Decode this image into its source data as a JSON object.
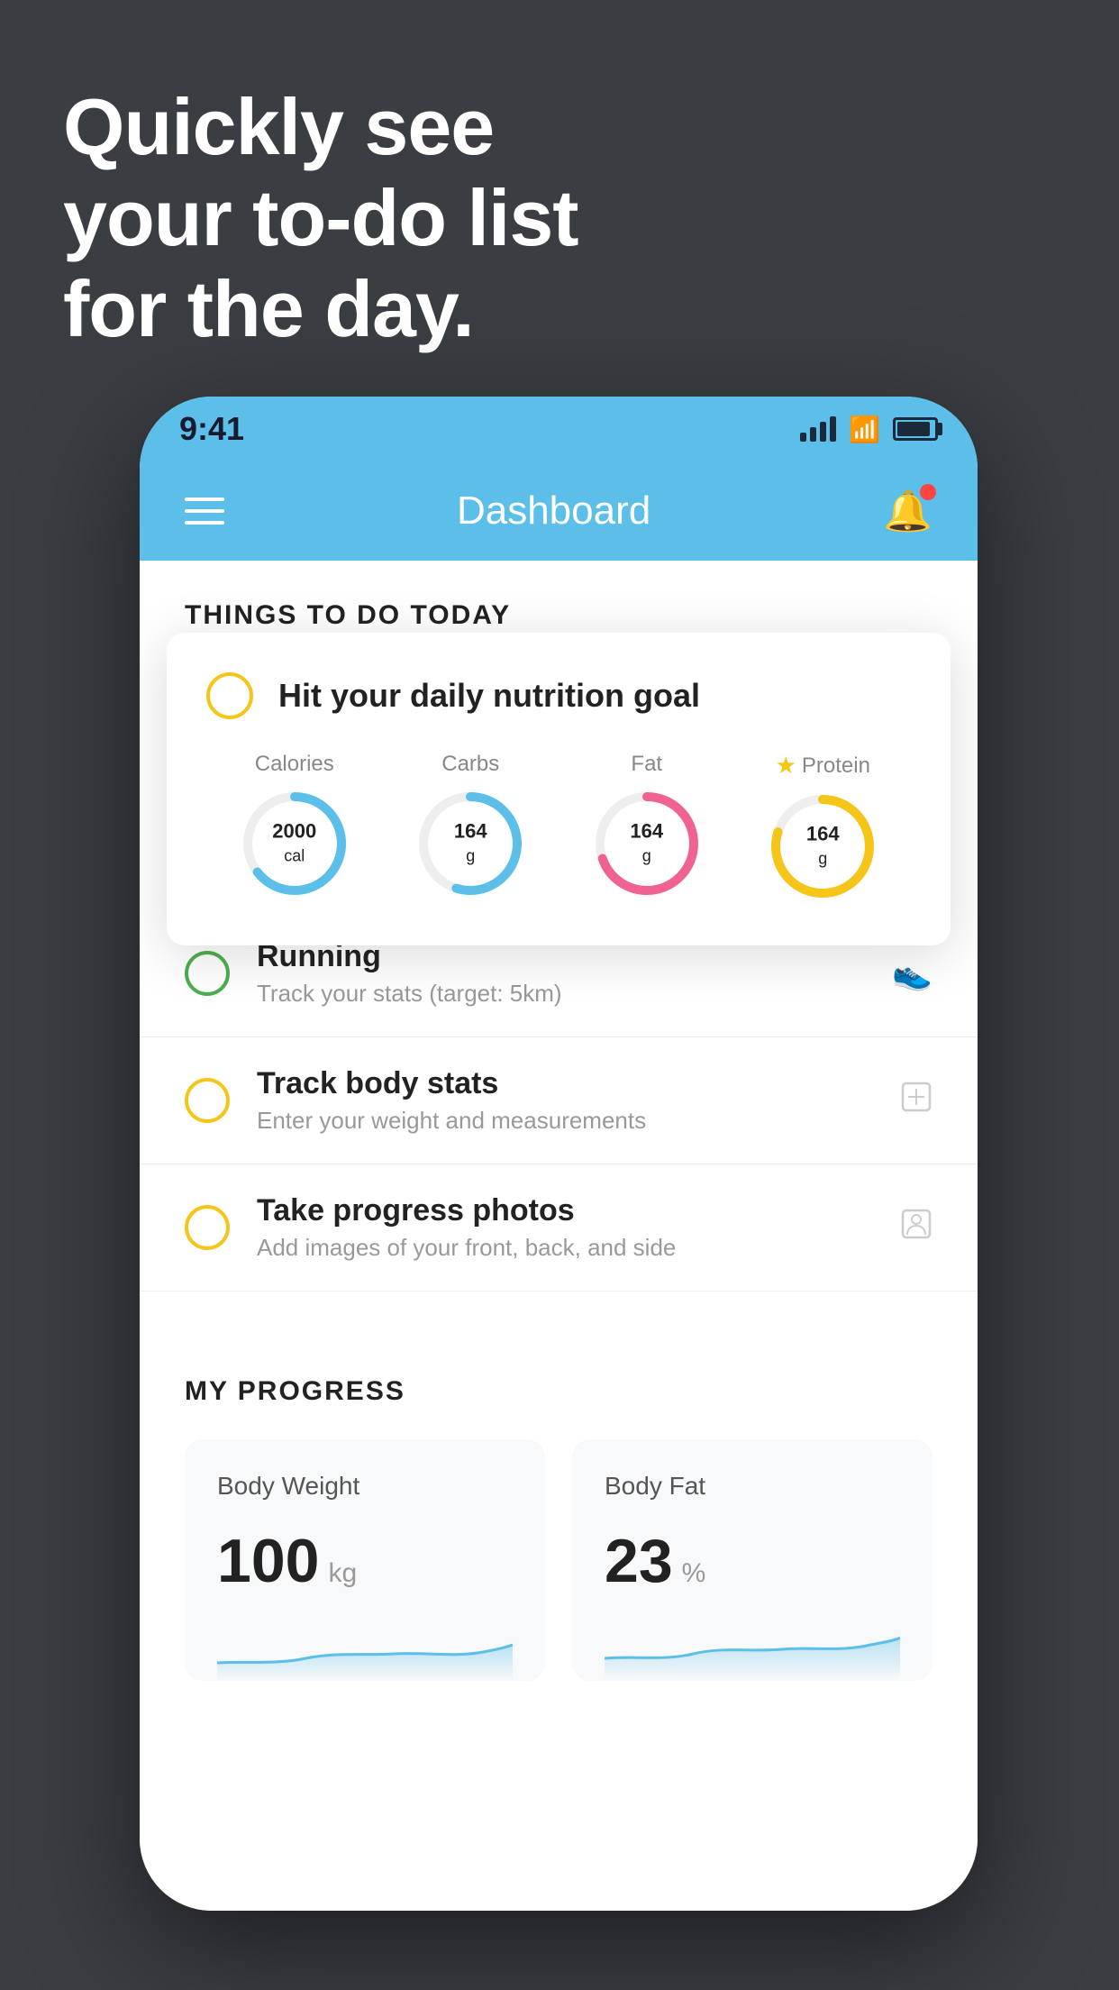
{
  "headline": {
    "line1": "Quickly see",
    "line2": "your to-do list",
    "line3": "for the day."
  },
  "status_bar": {
    "time": "9:41"
  },
  "nav": {
    "title": "Dashboard"
  },
  "things_section": {
    "header": "THINGS TO DO TODAY"
  },
  "floating_card": {
    "title": "Hit your daily nutrition goal",
    "nutrients": [
      {
        "label": "Calories",
        "value": "2000",
        "unit": "cal",
        "color": "#5bbfea",
        "percent": 65
      },
      {
        "label": "Carbs",
        "value": "164",
        "unit": "g",
        "color": "#5bbfea",
        "percent": 55
      },
      {
        "label": "Fat",
        "value": "164",
        "unit": "g",
        "color": "#f06292",
        "percent": 70
      },
      {
        "label": "Protein",
        "value": "164",
        "unit": "g",
        "color": "#f5c518",
        "percent": 80,
        "starred": true
      }
    ]
  },
  "todo_items": [
    {
      "title": "Running",
      "subtitle": "Track your stats (target: 5km)",
      "circle_color": "green",
      "icon": "👟"
    },
    {
      "title": "Track body stats",
      "subtitle": "Enter your weight and measurements",
      "circle_color": "yellow",
      "icon": "⊡"
    },
    {
      "title": "Take progress photos",
      "subtitle": "Add images of your front, back, and side",
      "circle_color": "yellow",
      "icon": "👤"
    }
  ],
  "progress_section": {
    "header": "MY PROGRESS",
    "cards": [
      {
        "title": "Body Weight",
        "value": "100",
        "unit": "kg"
      },
      {
        "title": "Body Fat",
        "value": "23",
        "unit": "%"
      }
    ]
  }
}
